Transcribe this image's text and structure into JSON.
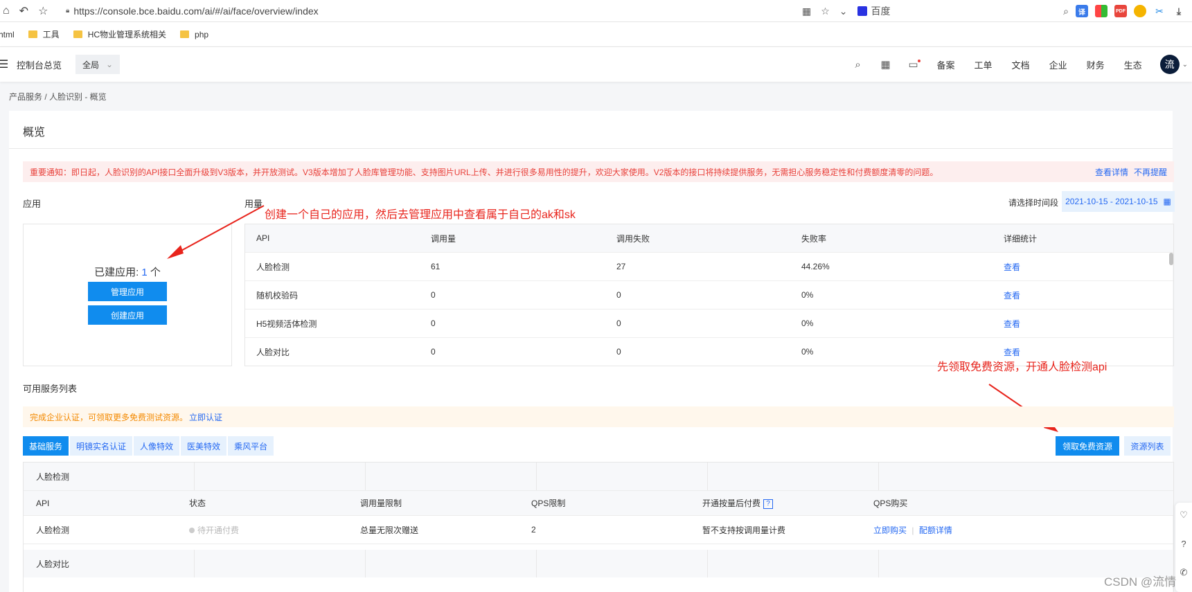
{
  "browser": {
    "url": "https://console.bce.baidu.com/ai/#/ai/face/overview/index",
    "search_engine": "百度",
    "bookmarks": [
      "html",
      "工具",
      "HC物业管理系统相关",
      "php"
    ]
  },
  "header": {
    "menu_icon": "hamburger-icon",
    "title": "控制台总览",
    "region": "全局",
    "links": [
      "备案",
      "工单",
      "文档",
      "企业",
      "财务",
      "生态"
    ],
    "avatar_text": "流"
  },
  "breadcrumb": "产品服务 / 人脸识别 - 概览",
  "page_title": "概览",
  "notice": {
    "text": "重要通知：即日起，人脸识别的API接口全面升级到V3版本，并开放测试。V3版本增加了人脸库管理功能、支持图片URL上传、并进行很多易用性的提升，欢迎大家使用。V2版本的接口将持续提供服务，无需担心服务稳定性和付费额度清零的问题。",
    "detail_link": "查看详情",
    "dismiss_link": "不再提醒"
  },
  "apps": {
    "label": "应用",
    "count_prefix": "已建应用: ",
    "count": "1",
    "count_suffix": " 个",
    "manage_button": "管理应用",
    "create_button": "创建应用"
  },
  "usage": {
    "label": "用量",
    "date_label": "请选择时间段",
    "date_range": "2021-10-15 - 2021-10-15",
    "columns": [
      "API",
      "调用量",
      "调用失败",
      "失败率",
      "详细统计"
    ],
    "rows": [
      [
        "人脸检测",
        "61",
        "27",
        "44.26%",
        "查看"
      ],
      [
        "随机校验码",
        "0",
        "0",
        "0%",
        "查看"
      ],
      [
        "H5视频活体检测",
        "0",
        "0",
        "0%",
        "查看"
      ],
      [
        "人脸对比",
        "0",
        "0",
        "0%",
        "查看"
      ]
    ]
  },
  "annotations": {
    "app_note": "创建一个自己的应用，然后去管理应用中查看属于自己的ak和sk",
    "free_note": "先领取免费资源，开通人脸检测api",
    "color": "#e8241c"
  },
  "services": {
    "label": "可用服务列表",
    "cert_text": "完成企业认证，可领取更多免费测试资源。",
    "cert_link": "立即认证",
    "tabs": [
      "基础服务",
      "明镜实名认证",
      "人像特效",
      "医美特效",
      "乘风平台"
    ],
    "free_button": "领取免费资源",
    "resource_button": "资源列表",
    "group1": "人脸检测",
    "columns": [
      "API",
      "状态",
      "调用量限制",
      "QPS限制",
      "开通按量后付费",
      "QPS购买"
    ],
    "help_mark": "?",
    "row": {
      "api": "人脸检测",
      "status": "待开通付费",
      "limit": "总量无限次赠送",
      "qps": "2",
      "postpaid": "暂不支持按调用量计费",
      "buy_link": "立即购买",
      "quota_link": "配额详情"
    },
    "group2": "人脸对比"
  },
  "colors": {
    "primary": "#108cee",
    "link": "#2468f2",
    "notice_red": "#e8403a",
    "warn_orange": "#f38900"
  },
  "watermark": "CSDN @流情"
}
